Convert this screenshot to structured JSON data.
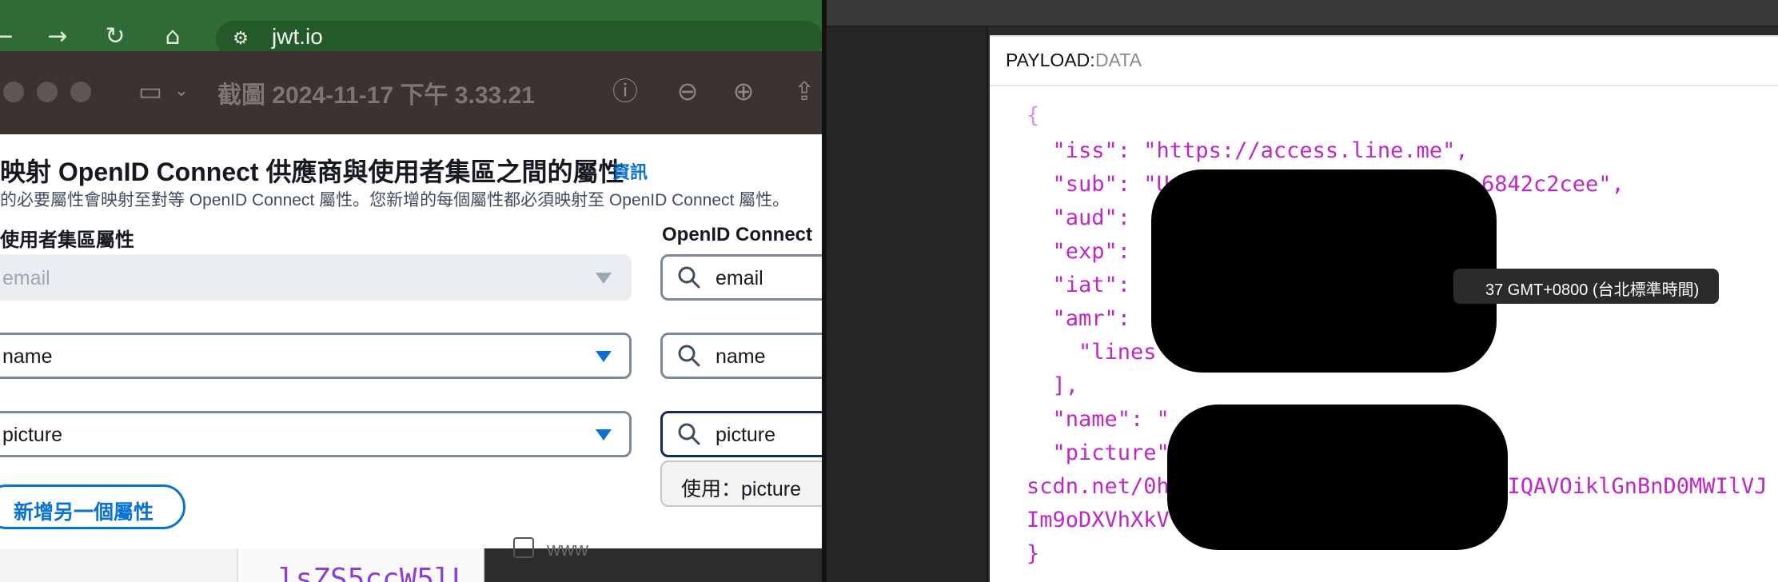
{
  "browser": {
    "url": "jwt.io",
    "icons": [
      "back-arrow-icon",
      "forward-arrow-icon",
      "reload-icon",
      "home-icon",
      "site-settings-icon"
    ]
  },
  "preview": {
    "title": "截圖 2024-11-17 下午 3.33.21",
    "icons": [
      "sidebar-icon",
      "chevron-down-icon",
      "info-icon",
      "zoom-out-icon",
      "zoom-in-icon",
      "share-icon"
    ]
  },
  "form": {
    "heading": "映射 OpenID Connect 供應商與使用者集區之間的屬性",
    "info_link": "資訊",
    "description": "的必要屬性會映射至對等 OpenID Connect 屬性。您新增的每個屬性都必須映射至 OpenID Connect 屬性。",
    "col_user_pool": "使用者集區屬性",
    "col_oidc": "OpenID Connect",
    "rows": [
      {
        "user_attr": "email",
        "oidc_attr": "email"
      },
      {
        "user_attr": "name",
        "oidc_attr": "name"
      },
      {
        "user_attr": "picture",
        "oidc_attr": "picture"
      }
    ],
    "suggestion": "使用：picture",
    "add_button": "新增另一個屬性"
  },
  "background": {
    "code_fragment": "lsZS5ccW5lL",
    "label": "www"
  },
  "payload": {
    "label": "PAYLOAD:",
    "sublabel": "DATA",
    "lines": [
      "{",
      "  \"iss\": \"https://access.line.me\",",
      "  \"sub\": \"U                        6842c2cee\",",
      "  \"aud\":",
      "  \"exp\":",
      "  \"iat\":",
      "  \"amr\":",
      "    \"lines",
      "  ],",
      "  \"name\": \"",
      "  \"picture\"",
      "scdn.net/0h                          IQAVOiklGnBnD0MWIlVJ",
      "Im9oDXVhXkV",
      "}"
    ],
    "tooltip": "37 GMT+0800 (台北標準時間)"
  }
}
